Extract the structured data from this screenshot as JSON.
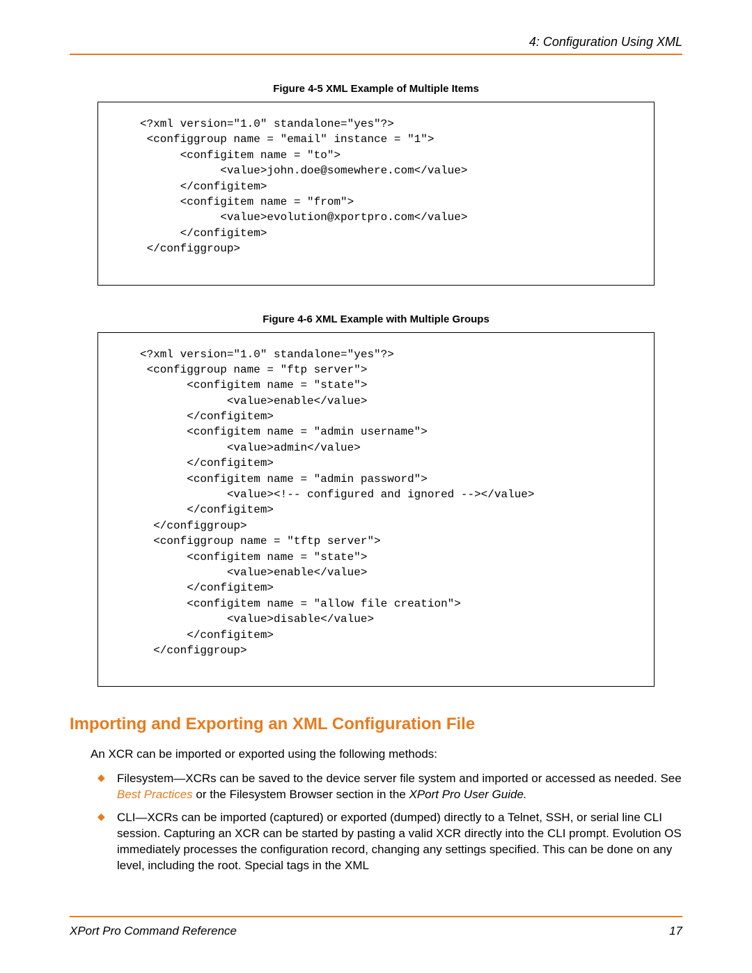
{
  "header": {
    "chapter": "4: Configuration Using XML"
  },
  "figure1": {
    "caption": "Figure 4-5  XML Example of Multiple Items",
    "code": "<?xml version=\"1.0\" standalone=\"yes\"?>\n <configgroup name = \"email\" instance = \"1\">\n      <configitem name = \"to\">\n            <value>john.doe@somewhere.com</value>\n      </configitem>\n      <configitem name = \"from\">\n            <value>evolution@xportpro.com</value>\n      </configitem>\n </configgroup>"
  },
  "figure2": {
    "caption": "Figure 4-6  XML Example with Multiple Groups",
    "code": "<?xml version=\"1.0\" standalone=\"yes\"?>\n <configgroup name = \"ftp server\">\n       <configitem name = \"state\">\n             <value>enable</value>\n       </configitem>\n       <configitem name = \"admin username\">\n             <value>admin</value>\n       </configitem>\n       <configitem name = \"admin password\">\n             <value><!-- configured and ignored --></value>\n       </configitem>\n  </configgroup>\n  <configgroup name = \"tftp server\">\n       <configitem name = \"state\">\n             <value>enable</value>\n       </configitem>\n       <configitem name = \"allow file creation\">\n             <value>disable</value>\n       </configitem>\n  </configgroup>"
  },
  "section": {
    "heading": "Importing and Exporting an XML Configuration File",
    "intro": "An XCR can be imported or exported using the following methods:",
    "bullet1_a": "Filesystem—XCRs can be saved to the device server file system and imported or accessed as needed. See ",
    "bullet1_link": "Best Practices",
    "bullet1_b": " or the Filesystem Browser section in the ",
    "bullet1_c": "XPort Pro User Guide.",
    "bullet2": "CLI—XCRs can be imported (captured) or exported (dumped) directly to a Telnet, SSH, or serial line CLI session. Capturing an XCR can be started by pasting a valid XCR directly into the CLI prompt. Evolution OS immediately processes the configuration record, changing any settings specified. This can be done on any level, including the root. Special tags in the XML"
  },
  "footer": {
    "left": "XPort Pro Command Reference",
    "right": "17"
  }
}
